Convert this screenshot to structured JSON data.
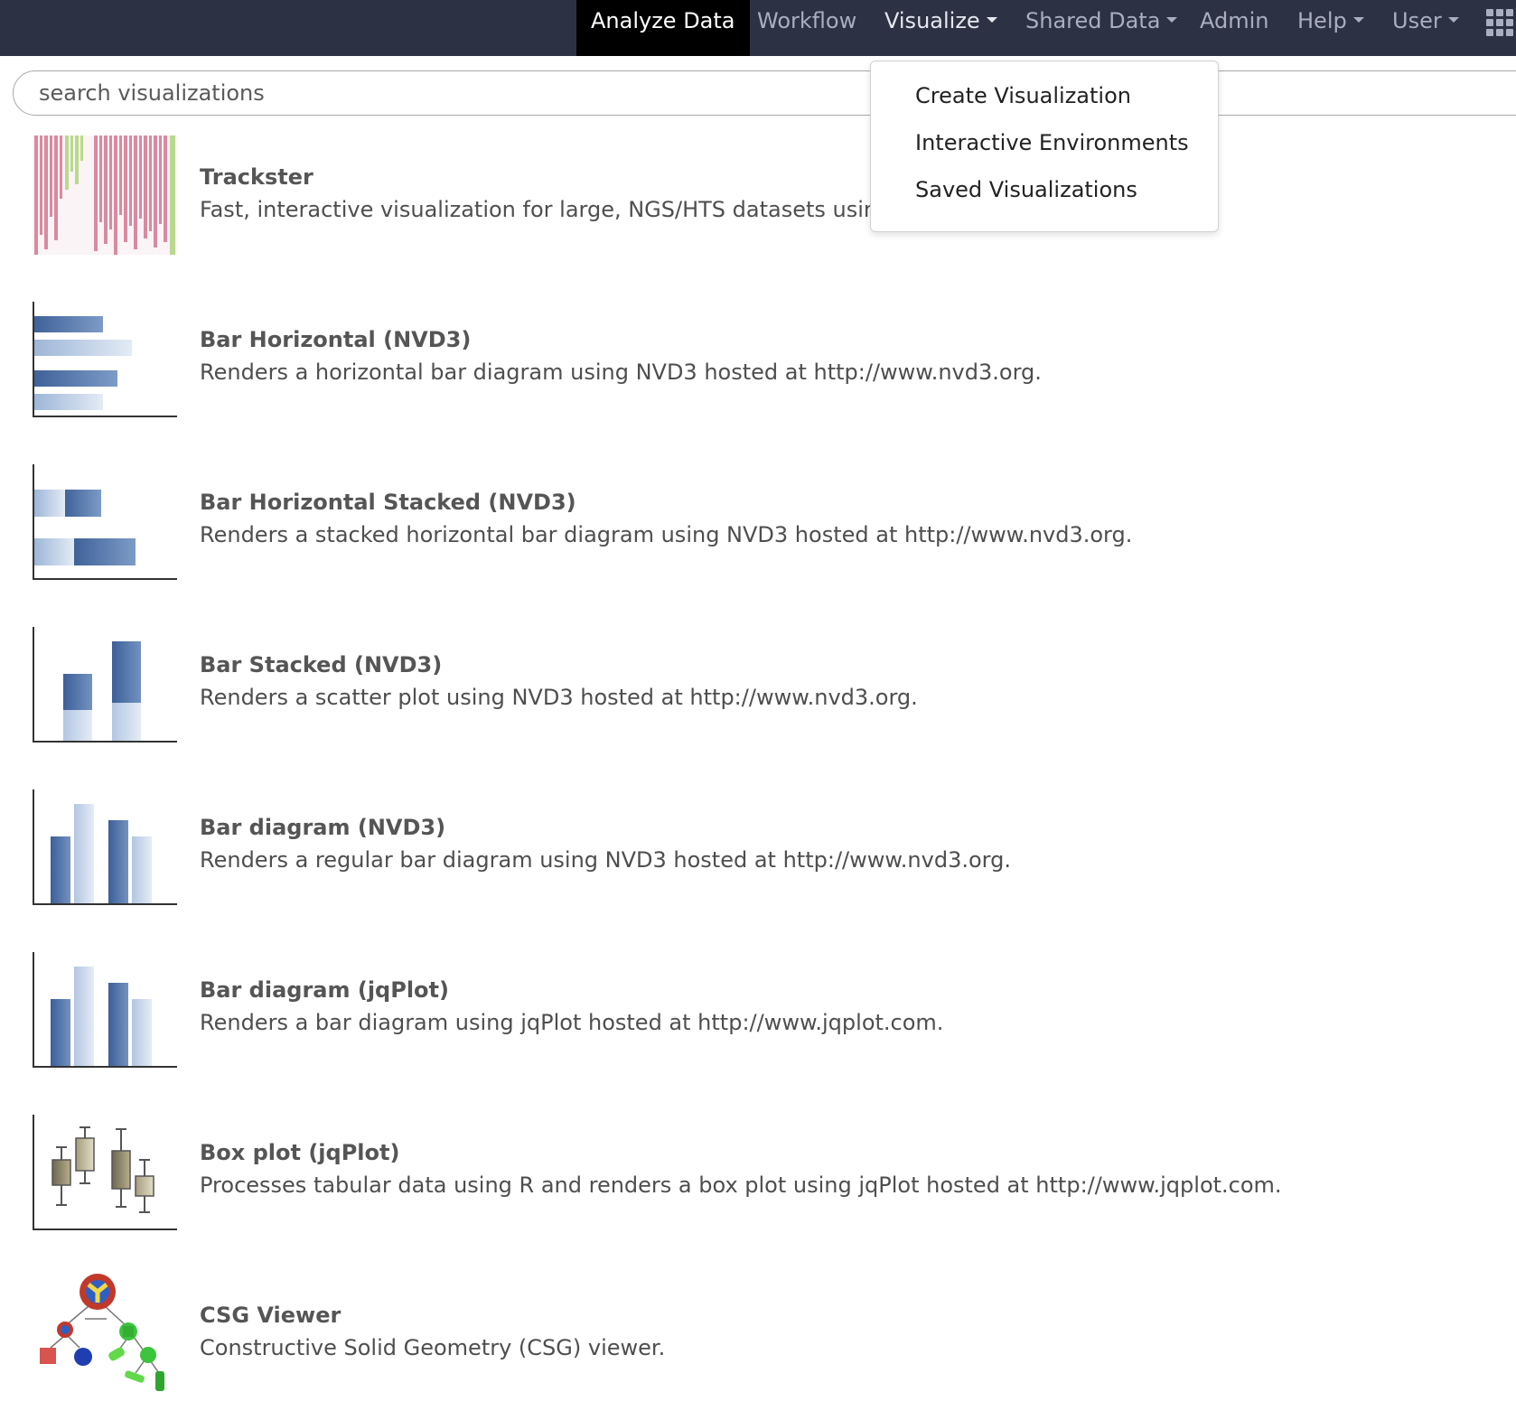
{
  "navbar": {
    "items": [
      {
        "label": "Analyze Data"
      },
      {
        "label": "Workflow"
      },
      {
        "label": "Visualize"
      },
      {
        "label": "Shared Data"
      },
      {
        "label": "Admin"
      },
      {
        "label": "Help"
      },
      {
        "label": "User"
      }
    ]
  },
  "search": {
    "placeholder": "search visualizations",
    "value": ""
  },
  "visualize_menu": {
    "items": [
      {
        "label": "Create Visualization"
      },
      {
        "label": "Interactive Environments"
      },
      {
        "label": "Saved Visualizations"
      }
    ]
  },
  "visualizations": [
    {
      "title": "Trackster",
      "description": "Fast, interactive visualization for large, NGS/HTS datasets using",
      "icon": "trackster-icon"
    },
    {
      "title": "Bar Horizontal (NVD3)",
      "description": "Renders a horizontal bar diagram using NVD3 hosted at http://www.nvd3.org.",
      "icon": "bar-horizontal-icon"
    },
    {
      "title": "Bar Horizontal Stacked (NVD3)",
      "description": "Renders a stacked horizontal bar diagram using NVD3 hosted at http://www.nvd3.org.",
      "icon": "bar-horizontal-stacked-icon"
    },
    {
      "title": "Bar Stacked (NVD3)",
      "description": "Renders a scatter plot using NVD3 hosted at http://www.nvd3.org.",
      "icon": "bar-stacked-icon"
    },
    {
      "title": "Bar diagram (NVD3)",
      "description": "Renders a regular bar diagram using NVD3 hosted at http://www.nvd3.org.",
      "icon": "bar-diagram-icon"
    },
    {
      "title": "Bar diagram (jqPlot)",
      "description": "Renders a bar diagram using jqPlot hosted at http://www.jqplot.com.",
      "icon": "bar-diagram-icon"
    },
    {
      "title": "Box plot (jqPlot)",
      "description": "Processes tabular data using R and renders a box plot using jqPlot hosted at http://www.jqplot.com.",
      "icon": "box-plot-icon"
    },
    {
      "title": "CSG Viewer",
      "description": "Constructive Solid Geometry (CSG) viewer.",
      "icon": "csg-viewer-icon"
    }
  ],
  "colors": {
    "navbar_bg": "#2c3143",
    "nav_text": "#a9afbe",
    "bar_dark": "#4a6fa5",
    "bar_light": "#c6d5ea",
    "trackster_pink": "#d98aa0",
    "trackster_green": "#b9d98c"
  }
}
